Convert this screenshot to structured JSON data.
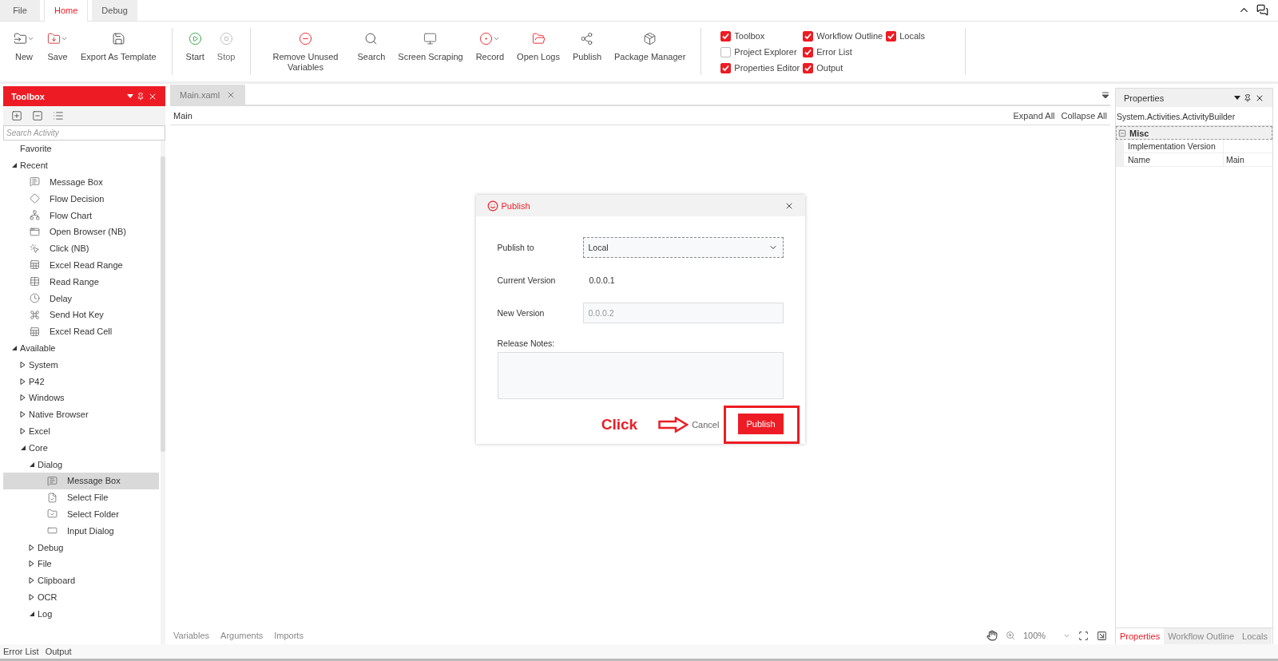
{
  "menu_tabs": [
    {
      "label": "File",
      "selected": false
    },
    {
      "label": "Home",
      "selected": true
    },
    {
      "label": "Debug",
      "selected": false
    }
  ],
  "ribbon": {
    "groups": [
      {
        "buttons": [
          {
            "label": "New",
            "has_menu": true
          },
          {
            "label": "Save",
            "has_menu": true
          },
          {
            "label": "Export As Template",
            "has_menu": false
          }
        ]
      },
      {
        "buttons": [
          {
            "label": "Start",
            "has_menu": false,
            "disabled": false
          },
          {
            "label": "Stop",
            "has_menu": false,
            "disabled": true
          }
        ]
      },
      {
        "buttons": [
          {
            "label": "Remove Unused Variables",
            "has_menu": false
          },
          {
            "label": "Search",
            "has_menu": false
          },
          {
            "label": "Screen Scraping",
            "has_menu": false
          },
          {
            "label": "Record",
            "has_menu": true
          },
          {
            "label": "Open Logs",
            "has_menu": false
          },
          {
            "label": "Publish",
            "has_menu": false
          },
          {
            "label": "Package Manager",
            "has_menu": false
          }
        ]
      }
    ],
    "panels": [
      {
        "label": "Toolbox",
        "checked": true
      },
      {
        "label": "Project Explorer",
        "checked": false
      },
      {
        "label": "Properties Editor",
        "checked": true
      },
      {
        "label": "Workflow Outline",
        "checked": true
      },
      {
        "label": "Error List",
        "checked": true
      },
      {
        "label": "Output",
        "checked": true
      },
      {
        "label": "Locals",
        "checked": true
      }
    ]
  },
  "toolbox": {
    "title": "Toolbox",
    "search": {
      "placeholder": "Search Activity"
    },
    "tree": [
      {
        "label": "Favorite"
      },
      {
        "label": "Recent",
        "expanded": true,
        "children": [
          {
            "label": "Message Box",
            "selected": false
          },
          {
            "label": "Flow Decision",
            "selected": false
          },
          {
            "label": "Flow Chart",
            "selected": false
          },
          {
            "label": "Open Browser (NB)",
            "selected": false
          },
          {
            "label": "Click (NB)",
            "selected": false
          },
          {
            "label": "Excel Read Range",
            "selected": false
          },
          {
            "label": "Read Range",
            "selected": false
          },
          {
            "label": "Delay",
            "selected": false
          },
          {
            "label": "Send Hot Key",
            "selected": false
          },
          {
            "label": "Excel Read Cell",
            "selected": false
          }
        ]
      },
      {
        "label": "Available",
        "expanded": true,
        "children": [
          {
            "label": "System",
            "expanded": false
          },
          {
            "label": "P42",
            "expanded": false
          },
          {
            "label": "Windows",
            "expanded": false
          },
          {
            "label": "Native Browser",
            "expanded": false
          },
          {
            "label": "Excel",
            "expanded": false
          },
          {
            "label": "Core",
            "expanded": true,
            "children": [
              {
                "label": "Dialog",
                "expanded": true,
                "children": [
                  {
                    "label": "Message Box",
                    "selected": true
                  },
                  {
                    "label": "Select File",
                    "selected": false
                  },
                  {
                    "label": "Select Folder",
                    "selected": false
                  },
                  {
                    "label": "Input Dialog",
                    "selected": false
                  }
                ]
              },
              {
                "label": "Debug",
                "expanded": false
              },
              {
                "label": "File",
                "expanded": false
              },
              {
                "label": "Clipboard",
                "expanded": false
              },
              {
                "label": "OCR",
                "expanded": false
              },
              {
                "label": "Log",
                "expanded": true
              }
            ]
          }
        ]
      }
    ]
  },
  "document": {
    "tab": "Main.xaml",
    "breadcrumb": "Main",
    "links": [
      "Expand All",
      "Collapse All"
    ],
    "footer_tabs": [
      "Variables",
      "Arguments",
      "Imports"
    ],
    "zoom": "100%"
  },
  "dialog": {
    "title": "Publish",
    "fields": [
      {
        "kind": "select",
        "label": "Publish to",
        "value": "Local"
      },
      {
        "kind": "text",
        "label": "Current Version",
        "value": "0.0.0.1"
      },
      {
        "kind": "input",
        "label": "New Version",
        "placeholder": "0.0.0.2"
      },
      {
        "kind": "textarea",
        "label": "Release Notes:"
      }
    ],
    "cancel": "Cancel",
    "confirm": "Publish"
  },
  "annotation": {
    "text": "Click"
  },
  "properties": {
    "title": "Properties",
    "type": "System.Activities.ActivityBuilder",
    "category": "Misc",
    "rows": [
      {
        "name": "Implementation Version"
      },
      {
        "name": "Name",
        "value": "Main"
      }
    ],
    "tabs": [
      {
        "label": "Properties",
        "selected": true
      },
      {
        "label": "Workflow Outline",
        "selected": false
      },
      {
        "label": "Locals",
        "selected": false
      }
    ]
  },
  "bottom_tabs": [
    "Error List",
    "Output"
  ]
}
